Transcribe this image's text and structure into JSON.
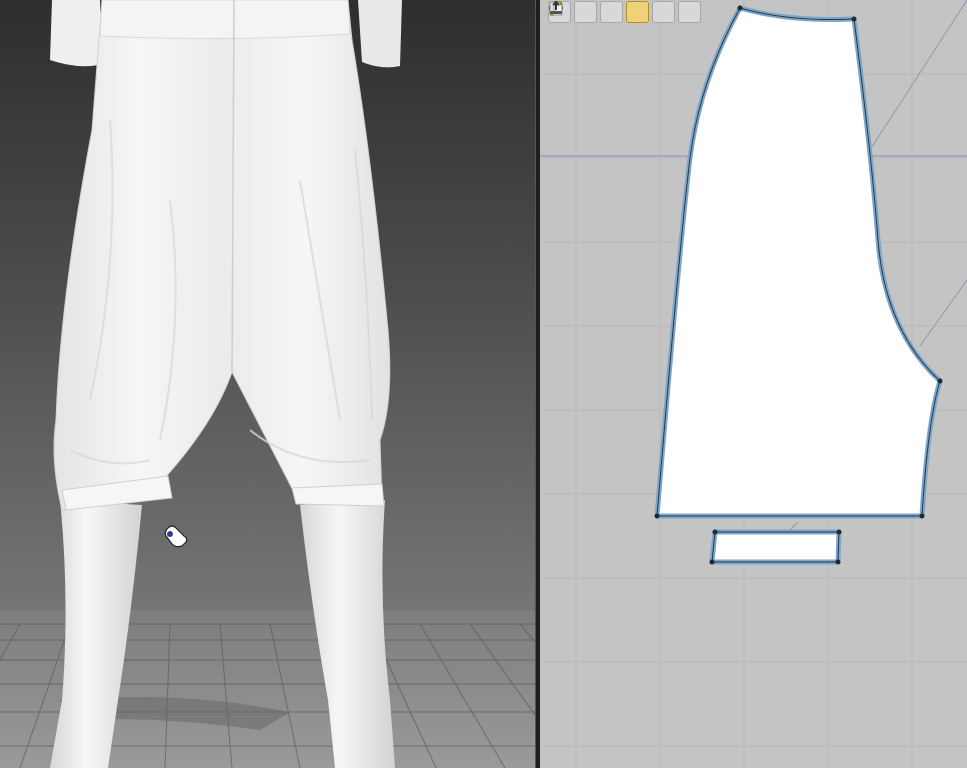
{
  "app": {
    "type": "3d-garment-design-editor"
  },
  "viewport_3d": {
    "background_top": "#2e2e2e",
    "background_bottom": "#8a8a8a",
    "garment_color": "#efefef",
    "avatar_color": "#f2f2f2",
    "floor_grid_color": "#555555",
    "cursor": "hand-cursor-icon"
  },
  "viewport_2d": {
    "background": "#c4c4c4",
    "grid_color": "#b6b6b6",
    "pattern_fill": "#ffffff",
    "pattern_outline": "#7fa6c9",
    "point_color": "#1c2a38",
    "toolbar": [
      {
        "name": "edit-pattern-icon",
        "active": false
      },
      {
        "name": "transform-pattern-icon",
        "active": false
      },
      {
        "name": "info-icon",
        "active": false
      },
      {
        "name": "select-piece-icon",
        "active": true
      },
      {
        "name": "pattern-duplicate-icon",
        "active": false
      },
      {
        "name": "export-icon",
        "active": false
      }
    ],
    "pattern_pieces": [
      "pant-leg-piece",
      "cuff-band-piece"
    ]
  }
}
